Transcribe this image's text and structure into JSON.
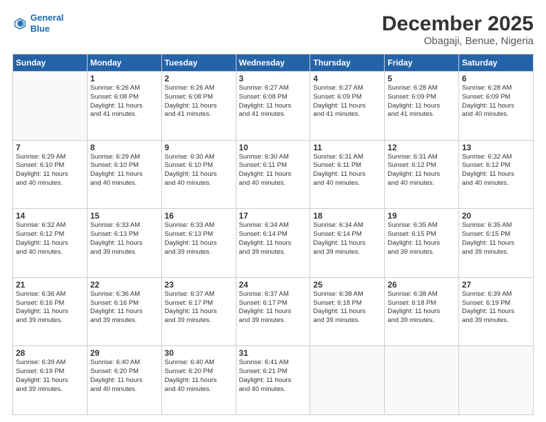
{
  "header": {
    "logo_line1": "General",
    "logo_line2": "Blue",
    "title": "December 2025",
    "subtitle": "Obagaji, Benue, Nigeria"
  },
  "days_of_week": [
    "Sunday",
    "Monday",
    "Tuesday",
    "Wednesday",
    "Thursday",
    "Friday",
    "Saturday"
  ],
  "weeks": [
    [
      {
        "day": "",
        "detail": ""
      },
      {
        "day": "1",
        "detail": "Sunrise: 6:26 AM\nSunset: 6:08 PM\nDaylight: 11 hours\nand 41 minutes."
      },
      {
        "day": "2",
        "detail": "Sunrise: 6:26 AM\nSunset: 6:08 PM\nDaylight: 11 hours\nand 41 minutes."
      },
      {
        "day": "3",
        "detail": "Sunrise: 6:27 AM\nSunset: 6:08 PM\nDaylight: 11 hours\nand 41 minutes."
      },
      {
        "day": "4",
        "detail": "Sunrise: 6:27 AM\nSunset: 6:09 PM\nDaylight: 11 hours\nand 41 minutes."
      },
      {
        "day": "5",
        "detail": "Sunrise: 6:28 AM\nSunset: 6:09 PM\nDaylight: 11 hours\nand 41 minutes."
      },
      {
        "day": "6",
        "detail": "Sunrise: 6:28 AM\nSunset: 6:09 PM\nDaylight: 11 hours\nand 40 minutes."
      }
    ],
    [
      {
        "day": "7",
        "detail": "Sunrise: 6:29 AM\nSunset: 6:10 PM\nDaylight: 11 hours\nand 40 minutes."
      },
      {
        "day": "8",
        "detail": "Sunrise: 6:29 AM\nSunset: 6:10 PM\nDaylight: 11 hours\nand 40 minutes."
      },
      {
        "day": "9",
        "detail": "Sunrise: 6:30 AM\nSunset: 6:10 PM\nDaylight: 11 hours\nand 40 minutes."
      },
      {
        "day": "10",
        "detail": "Sunrise: 6:30 AM\nSunset: 6:11 PM\nDaylight: 11 hours\nand 40 minutes."
      },
      {
        "day": "11",
        "detail": "Sunrise: 6:31 AM\nSunset: 6:11 PM\nDaylight: 11 hours\nand 40 minutes."
      },
      {
        "day": "12",
        "detail": "Sunrise: 6:31 AM\nSunset: 6:12 PM\nDaylight: 11 hours\nand 40 minutes."
      },
      {
        "day": "13",
        "detail": "Sunrise: 6:32 AM\nSunset: 6:12 PM\nDaylight: 11 hours\nand 40 minutes."
      }
    ],
    [
      {
        "day": "14",
        "detail": "Sunrise: 6:32 AM\nSunset: 6:12 PM\nDaylight: 11 hours\nand 40 minutes."
      },
      {
        "day": "15",
        "detail": "Sunrise: 6:33 AM\nSunset: 6:13 PM\nDaylight: 11 hours\nand 39 minutes."
      },
      {
        "day": "16",
        "detail": "Sunrise: 6:33 AM\nSunset: 6:13 PM\nDaylight: 11 hours\nand 39 minutes."
      },
      {
        "day": "17",
        "detail": "Sunrise: 6:34 AM\nSunset: 6:14 PM\nDaylight: 11 hours\nand 39 minutes."
      },
      {
        "day": "18",
        "detail": "Sunrise: 6:34 AM\nSunset: 6:14 PM\nDaylight: 11 hours\nand 39 minutes."
      },
      {
        "day": "19",
        "detail": "Sunrise: 6:35 AM\nSunset: 6:15 PM\nDaylight: 11 hours\nand 39 minutes."
      },
      {
        "day": "20",
        "detail": "Sunrise: 6:35 AM\nSunset: 6:15 PM\nDaylight: 11 hours\nand 39 minutes."
      }
    ],
    [
      {
        "day": "21",
        "detail": "Sunrise: 6:36 AM\nSunset: 6:16 PM\nDaylight: 11 hours\nand 39 minutes."
      },
      {
        "day": "22",
        "detail": "Sunrise: 6:36 AM\nSunset: 6:16 PM\nDaylight: 11 hours\nand 39 minutes."
      },
      {
        "day": "23",
        "detail": "Sunrise: 6:37 AM\nSunset: 6:17 PM\nDaylight: 11 hours\nand 39 minutes."
      },
      {
        "day": "24",
        "detail": "Sunrise: 6:37 AM\nSunset: 6:17 PM\nDaylight: 11 hours\nand 39 minutes."
      },
      {
        "day": "25",
        "detail": "Sunrise: 6:38 AM\nSunset: 6:18 PM\nDaylight: 11 hours\nand 39 minutes."
      },
      {
        "day": "26",
        "detail": "Sunrise: 6:38 AM\nSunset: 6:18 PM\nDaylight: 11 hours\nand 39 minutes."
      },
      {
        "day": "27",
        "detail": "Sunrise: 6:39 AM\nSunset: 6:19 PM\nDaylight: 11 hours\nand 39 minutes."
      }
    ],
    [
      {
        "day": "28",
        "detail": "Sunrise: 6:39 AM\nSunset: 6:19 PM\nDaylight: 11 hours\nand 39 minutes."
      },
      {
        "day": "29",
        "detail": "Sunrise: 6:40 AM\nSunset: 6:20 PM\nDaylight: 11 hours\nand 40 minutes."
      },
      {
        "day": "30",
        "detail": "Sunrise: 6:40 AM\nSunset: 6:20 PM\nDaylight: 11 hours\nand 40 minutes."
      },
      {
        "day": "31",
        "detail": "Sunrise: 6:41 AM\nSunset: 6:21 PM\nDaylight: 11 hours\nand 40 minutes."
      },
      {
        "day": "",
        "detail": ""
      },
      {
        "day": "",
        "detail": ""
      },
      {
        "day": "",
        "detail": ""
      }
    ]
  ]
}
